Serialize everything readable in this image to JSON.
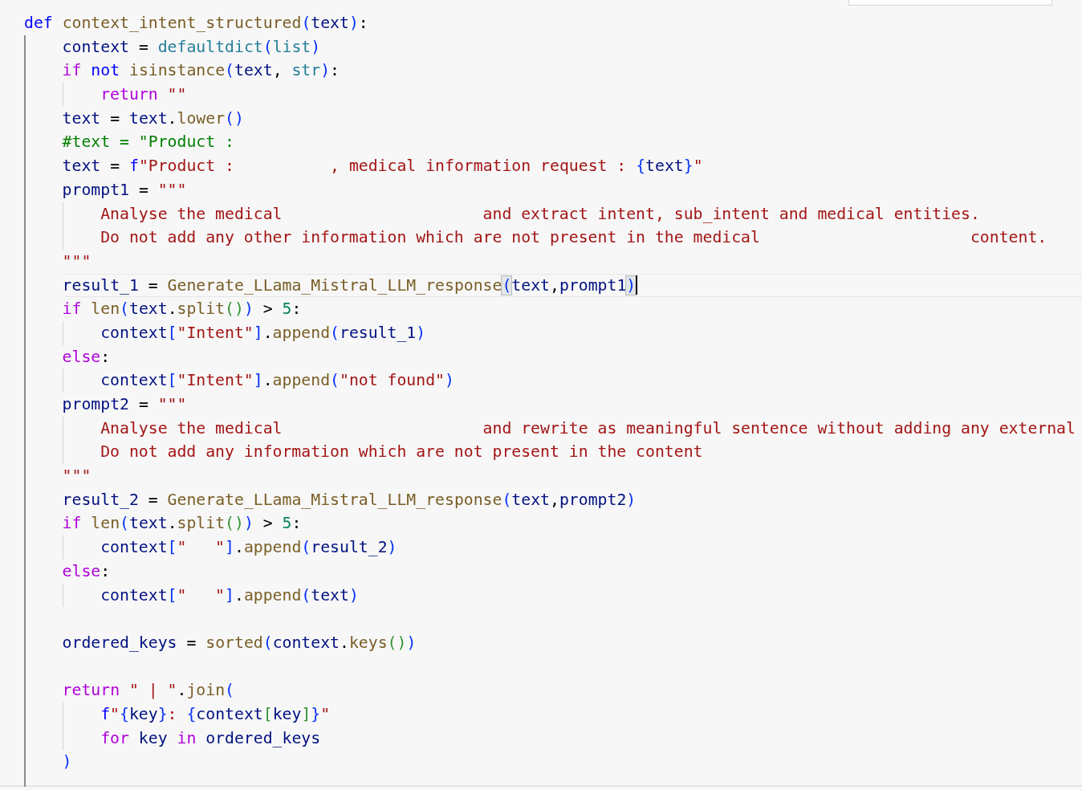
{
  "editor": {
    "lines": [
      {
        "current": false,
        "tokens": [
          {
            "kind": "kw",
            "text": "def "
          },
          {
            "kind": "fn",
            "text": "context_intent_structured"
          },
          {
            "kind": "b1",
            "text": "("
          },
          {
            "kind": "var",
            "text": "text"
          },
          {
            "kind": "b1",
            "text": ")"
          },
          {
            "kind": "op",
            "text": ":"
          }
        ],
        "children": [
          {
            "current": false,
            "tokens": [
              {
                "kind": "var",
                "text": "context"
              },
              {
                "kind": "op",
                "text": " = "
              },
              {
                "kind": "typ",
                "text": "defaultdict"
              },
              {
                "kind": "b1",
                "text": "("
              },
              {
                "kind": "typ",
                "text": "list"
              },
              {
                "kind": "b1",
                "text": ")"
              }
            ]
          },
          {
            "current": false,
            "tokens": [
              {
                "kind": "ctl",
                "text": "if "
              },
              {
                "kind": "kw",
                "text": "not "
              },
              {
                "kind": "fn",
                "text": "isinstance"
              },
              {
                "kind": "b1",
                "text": "("
              },
              {
                "kind": "var",
                "text": "text"
              },
              {
                "kind": "op",
                "text": ", "
              },
              {
                "kind": "typ",
                "text": "str"
              },
              {
                "kind": "b1",
                "text": ")"
              },
              {
                "kind": "op",
                "text": ":"
              }
            ],
            "children": [
              {
                "current": false,
                "tokens": [
                  {
                    "kind": "ctl",
                    "text": "return "
                  },
                  {
                    "kind": "str",
                    "text": "\"\""
                  }
                ]
              }
            ]
          },
          {
            "current": false,
            "tokens": [
              {
                "kind": "var",
                "text": "text"
              },
              {
                "kind": "op",
                "text": " = "
              },
              {
                "kind": "var",
                "text": "text"
              },
              {
                "kind": "op",
                "text": "."
              },
              {
                "kind": "fn",
                "text": "lower"
              },
              {
                "kind": "b1",
                "text": "("
              },
              {
                "kind": "b1",
                "text": ")"
              }
            ]
          },
          {
            "current": false,
            "tokens": [
              {
                "kind": "cmt",
                "text": "#text = \"Product :"
              }
            ]
          },
          {
            "current": false,
            "tokens": [
              {
                "kind": "var",
                "text": "text"
              },
              {
                "kind": "op",
                "text": " = "
              },
              {
                "kind": "kw",
                "text": "f"
              },
              {
                "kind": "str",
                "text": "\"Product :          , medical information request : "
              },
              {
                "kind": "b1",
                "text": "{"
              },
              {
                "kind": "var",
                "text": "text"
              },
              {
                "kind": "b1",
                "text": "}"
              },
              {
                "kind": "str",
                "text": "\""
              }
            ]
          },
          {
            "current": false,
            "tokens": [
              {
                "kind": "var",
                "text": "prompt1"
              },
              {
                "kind": "op",
                "text": " = "
              },
              {
                "kind": "str",
                "text": "\"\"\""
              }
            ],
            "children": [
              {
                "current": false,
                "tokens": [
                  {
                    "kind": "str",
                    "text": "Analyse the medical                     and extract intent, sub_intent and medical entities."
                  }
                ]
              },
              {
                "current": false,
                "tokens": [
                  {
                    "kind": "str",
                    "text": "Do not add any other information which are not present in the medical                      content."
                  }
                ]
              }
            ]
          },
          {
            "current": false,
            "tokens": [
              {
                "kind": "str",
                "text": "\"\"\""
              }
            ]
          },
          {
            "current": true,
            "tokens": [
              {
                "kind": "var",
                "text": "result_1"
              },
              {
                "kind": "op",
                "text": " = "
              },
              {
                "kind": "fn",
                "text": "Generate_LLama_Mistral_LLM_response"
              },
              {
                "kind": "pm",
                "text": "("
              },
              {
                "kind": "var",
                "text": "text"
              },
              {
                "kind": "op",
                "text": ","
              },
              {
                "kind": "var",
                "text": "prompt1"
              },
              {
                "kind": "pm",
                "text": ")"
              }
            ]
          },
          {
            "current": false,
            "tokens": [
              {
                "kind": "ctl",
                "text": "if "
              },
              {
                "kind": "fn",
                "text": "len"
              },
              {
                "kind": "b1",
                "text": "("
              },
              {
                "kind": "var",
                "text": "text"
              },
              {
                "kind": "op",
                "text": "."
              },
              {
                "kind": "fn",
                "text": "split"
              },
              {
                "kind": "b2",
                "text": "("
              },
              {
                "kind": "b2",
                "text": ")"
              },
              {
                "kind": "b1",
                "text": ")"
              },
              {
                "kind": "op",
                "text": " > "
              },
              {
                "kind": "num",
                "text": "5"
              },
              {
                "kind": "op",
                "text": ":"
              }
            ],
            "children": [
              {
                "current": false,
                "tokens": [
                  {
                    "kind": "var",
                    "text": "context"
                  },
                  {
                    "kind": "b1",
                    "text": "["
                  },
                  {
                    "kind": "str",
                    "text": "\"Intent\""
                  },
                  {
                    "kind": "b1",
                    "text": "]"
                  },
                  {
                    "kind": "op",
                    "text": "."
                  },
                  {
                    "kind": "fn",
                    "text": "append"
                  },
                  {
                    "kind": "b1",
                    "text": "("
                  },
                  {
                    "kind": "var",
                    "text": "result_1"
                  },
                  {
                    "kind": "b1",
                    "text": ")"
                  }
                ]
              }
            ]
          },
          {
            "current": false,
            "tokens": [
              {
                "kind": "ctl",
                "text": "else"
              },
              {
                "kind": "op",
                "text": ":"
              }
            ],
            "children": [
              {
                "current": false,
                "tokens": [
                  {
                    "kind": "var",
                    "text": "context"
                  },
                  {
                    "kind": "b1",
                    "text": "["
                  },
                  {
                    "kind": "str",
                    "text": "\"Intent\""
                  },
                  {
                    "kind": "b1",
                    "text": "]"
                  },
                  {
                    "kind": "op",
                    "text": "."
                  },
                  {
                    "kind": "fn",
                    "text": "append"
                  },
                  {
                    "kind": "b1",
                    "text": "("
                  },
                  {
                    "kind": "str",
                    "text": "\"not found\""
                  },
                  {
                    "kind": "b1",
                    "text": ")"
                  }
                ]
              }
            ]
          },
          {
            "current": false,
            "tokens": [
              {
                "kind": "var",
                "text": "prompt2"
              },
              {
                "kind": "op",
                "text": " = "
              },
              {
                "kind": "str",
                "text": "\"\"\""
              }
            ],
            "children": [
              {
                "current": false,
                "tokens": [
                  {
                    "kind": "str",
                    "text": "Analyse the medical                     and rewrite as meaningful sentence without adding any external"
                  }
                ]
              },
              {
                "current": false,
                "tokens": [
                  {
                    "kind": "str",
                    "text": "Do not add any information which are not present in the content"
                  }
                ]
              }
            ]
          },
          {
            "current": false,
            "tokens": [
              {
                "kind": "str",
                "text": "\"\"\""
              }
            ]
          },
          {
            "current": false,
            "tokens": [
              {
                "kind": "var",
                "text": "result_2"
              },
              {
                "kind": "op",
                "text": " = "
              },
              {
                "kind": "fn",
                "text": "Generate_LLama_Mistral_LLM_response"
              },
              {
                "kind": "b1",
                "text": "("
              },
              {
                "kind": "var",
                "text": "text"
              },
              {
                "kind": "op",
                "text": ","
              },
              {
                "kind": "var",
                "text": "prompt2"
              },
              {
                "kind": "b1",
                "text": ")"
              }
            ]
          },
          {
            "current": false,
            "tokens": [
              {
                "kind": "ctl",
                "text": "if "
              },
              {
                "kind": "fn",
                "text": "len"
              },
              {
                "kind": "b1",
                "text": "("
              },
              {
                "kind": "var",
                "text": "text"
              },
              {
                "kind": "op",
                "text": "."
              },
              {
                "kind": "fn",
                "text": "split"
              },
              {
                "kind": "b2",
                "text": "("
              },
              {
                "kind": "b2",
                "text": ")"
              },
              {
                "kind": "b1",
                "text": ")"
              },
              {
                "kind": "op",
                "text": " > "
              },
              {
                "kind": "num",
                "text": "5"
              },
              {
                "kind": "op",
                "text": ":"
              }
            ],
            "children": [
              {
                "current": false,
                "tokens": [
                  {
                    "kind": "var",
                    "text": "context"
                  },
                  {
                    "kind": "b1",
                    "text": "["
                  },
                  {
                    "kind": "str",
                    "text": "\"   \""
                  },
                  {
                    "kind": "b1",
                    "text": "]"
                  },
                  {
                    "kind": "op",
                    "text": "."
                  },
                  {
                    "kind": "fn",
                    "text": "append"
                  },
                  {
                    "kind": "b1",
                    "text": "("
                  },
                  {
                    "kind": "var",
                    "text": "result_2"
                  },
                  {
                    "kind": "b1",
                    "text": ")"
                  }
                ]
              }
            ]
          },
          {
            "current": false,
            "tokens": [
              {
                "kind": "ctl",
                "text": "else"
              },
              {
                "kind": "op",
                "text": ":"
              }
            ],
            "children": [
              {
                "current": false,
                "tokens": [
                  {
                    "kind": "var",
                    "text": "context"
                  },
                  {
                    "kind": "b1",
                    "text": "["
                  },
                  {
                    "kind": "str",
                    "text": "\"   \""
                  },
                  {
                    "kind": "b1",
                    "text": "]"
                  },
                  {
                    "kind": "op",
                    "text": "."
                  },
                  {
                    "kind": "fn",
                    "text": "append"
                  },
                  {
                    "kind": "b1",
                    "text": "("
                  },
                  {
                    "kind": "var",
                    "text": "text"
                  },
                  {
                    "kind": "b1",
                    "text": ")"
                  }
                ]
              }
            ]
          },
          {
            "current": false
          },
          {
            "current": false,
            "tokens": [
              {
                "kind": "var",
                "text": "ordered_keys"
              },
              {
                "kind": "op",
                "text": " = "
              },
              {
                "kind": "fn",
                "text": "sorted"
              },
              {
                "kind": "b1",
                "text": "("
              },
              {
                "kind": "var",
                "text": "context"
              },
              {
                "kind": "op",
                "text": "."
              },
              {
                "kind": "fn",
                "text": "keys"
              },
              {
                "kind": "b2",
                "text": "("
              },
              {
                "kind": "b2",
                "text": ")"
              },
              {
                "kind": "b1",
                "text": ")"
              }
            ]
          },
          {
            "current": false
          },
          {
            "current": false,
            "tokens": [
              {
                "kind": "ctl",
                "text": "return "
              },
              {
                "kind": "str",
                "text": "\" | \""
              },
              {
                "kind": "op",
                "text": "."
              },
              {
                "kind": "fn",
                "text": "join"
              },
              {
                "kind": "b1",
                "text": "("
              }
            ],
            "children": [
              {
                "current": false,
                "tokens": [
                  {
                    "kind": "kw",
                    "text": "f"
                  },
                  {
                    "kind": "str",
                    "text": "\""
                  },
                  {
                    "kind": "b1",
                    "text": "{"
                  },
                  {
                    "kind": "var",
                    "text": "key"
                  },
                  {
                    "kind": "b1",
                    "text": "}"
                  },
                  {
                    "kind": "str",
                    "text": ": "
                  },
                  {
                    "kind": "b1",
                    "text": "{"
                  },
                  {
                    "kind": "var",
                    "text": "context"
                  },
                  {
                    "kind": "b2",
                    "text": "["
                  },
                  {
                    "kind": "var",
                    "text": "key"
                  },
                  {
                    "kind": "b2",
                    "text": "]"
                  },
                  {
                    "kind": "b1",
                    "text": "}"
                  },
                  {
                    "kind": "str",
                    "text": "\""
                  }
                ]
              },
              {
                "current": false,
                "tokens": [
                  {
                    "kind": "ctl",
                    "text": "for "
                  },
                  {
                    "kind": "var",
                    "text": "key "
                  },
                  {
                    "kind": "ctl",
                    "text": "in "
                  },
                  {
                    "kind": "var",
                    "text": "ordered_keys"
                  }
                ]
              }
            ]
          },
          {
            "current": false,
            "tokens": [
              {
                "kind": "b1",
                "text": ")"
              }
            ]
          }
        ]
      }
    ]
  }
}
